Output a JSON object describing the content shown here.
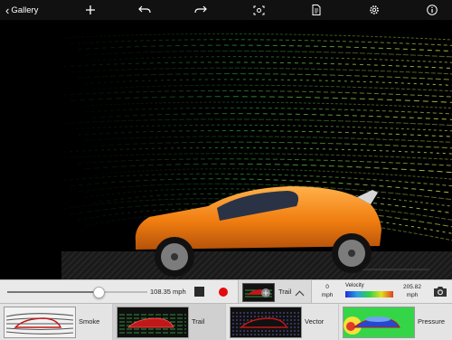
{
  "toolbar": {
    "back_label": "Gallery",
    "icons": [
      "chevron-left-icon",
      "plus-icon",
      "undo-icon",
      "redo-icon",
      "camera-reset-icon",
      "document-icon",
      "gear-icon",
      "info-icon"
    ]
  },
  "controls": {
    "speed_value": "108.35 mph",
    "slider_fraction": 0.65,
    "selected_mode_label": "Trail",
    "velocity_label": "Velocity",
    "velocity_min_value": "0",
    "velocity_min_unit": "mph",
    "velocity_max_value": "205.82",
    "velocity_max_unit": "mph",
    "colors": {
      "record": "#e30b0b",
      "car_body": "#f08a15",
      "stream_start": "#1d9a3a",
      "stream_end": "#c6e84a"
    }
  },
  "modes": [
    {
      "label": "Smoke",
      "selected": false
    },
    {
      "label": "Trail",
      "selected": true
    },
    {
      "label": "Vector",
      "selected": false
    },
    {
      "label": "Pressure",
      "selected": false
    }
  ]
}
